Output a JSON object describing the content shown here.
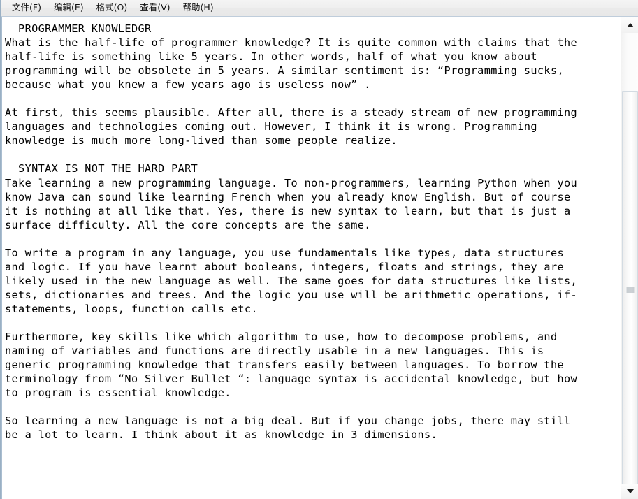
{
  "window": {
    "app_name": "notepad",
    "border_color": "#9ab0c4"
  },
  "menubar": {
    "items": [
      {
        "name": "file",
        "label": "文件(F)"
      },
      {
        "name": "edit",
        "label": "编辑(E)"
      },
      {
        "name": "format",
        "label": "格式(O)"
      },
      {
        "name": "view",
        "label": "查看(V)"
      },
      {
        "name": "help",
        "label": "帮助(H)"
      }
    ]
  },
  "editor": {
    "text": "  PROGRAMMER KNOWLEDGR\nWhat is the half-life of programmer knowledge? It is quite common with claims that the\nhalf-life is something like 5 years. In other words, half of what you know about\nprogramming will be obsolete in 5 years. A similar sentiment is: “Programming sucks,\nbecause what you knew a few years ago is useless now” .\n\nAt first, this seems plausible. After all, there is a steady stream of new programming\nlanguages and technologies coming out. However, I think it is wrong. Programming\nknowledge is much more long-lived than some people realize.\n\n  SYNTAX IS NOT THE HARD PART\nTake learning a new programming language. To non-programmers, learning Python when you\nknow Java can sound like learning French when you already know English. But of course\nit is nothing at all like that. Yes, there is new syntax to learn, but that is just a\nsurface difficulty. All the core concepts are the same.\n\nTo write a program in any language, you use fundamentals like types, data structures\nand logic. If you have learnt about booleans, integers, floats and strings, they are\nlikely used in the new language as well. The same goes for data structures like lists,\nsets, dictionaries and trees. And the logic you use will be arithmetic operations, if-\nstatements, loops, function calls etc.\n\nFurthermore, key skills like which algorithm to use, how to decompose problems, and\nnaming of variables and functions are directly usable in a new languages. This is\ngeneric programming knowledge that transfers easily between languages. To borrow the\nterminology from “No Silver Bullet “: language syntax is accidental knowledge, but how\nto program is essential knowledge.\n\nSo learning a new language is not a big deal. But if you change jobs, there may still\nbe a lot to learn. I think about it as knowledge in 3 dimensions.",
    "lines": [
      "  PROGRAMMER KNOWLEDGR",
      "What is the half-life of programmer knowledge? It is quite common with claims that the",
      "half-life is something like 5 years. In other words, half of what you know about",
      "programming will be obsolete in 5 years. A similar sentiment is: “Programming sucks,",
      "because what you knew a few years ago is useless now” .",
      "",
      "At first, this seems plausible. After all, there is a steady stream of new programming",
      "languages and technologies coming out. However, I think it is wrong. Programming",
      "knowledge is much more long-lived than some people realize.",
      "",
      "  SYNTAX IS NOT THE HARD PART",
      "Take learning a new programming language. To non-programmers, learning Python when you",
      "know Java can sound like learning French when you already know English. But of course",
      "it is nothing at all like that. Yes, there is new syntax to learn, but that is just a",
      "surface difficulty. All the core concepts are the same.",
      "",
      "To write a program in any language, you use fundamentals like types, data structures",
      "and logic. If you have learnt about booleans, integers, floats and strings, they are",
      "likely used in the new language as well. The same goes for data structures like lists,",
      "sets, dictionaries and trees. And the logic you use will be arithmetic operations, if-",
      "statements, loops, function calls etc.",
      "",
      "Furthermore, key skills like which algorithm to use, how to decompose problems, and",
      "naming of variables and functions are directly usable in a new languages. This is",
      "generic programming knowledge that transfers easily between languages. To borrow the",
      "terminology from “No Silver Bullet “: language syntax is accidental knowledge, but how",
      "to program is essential knowledge.",
      "",
      "So learning a new language is not a big deal. But if you change jobs, there may still",
      "be a lot to learn. I think about it as knowledge in 3 dimensions."
    ]
  },
  "scrollbar": {
    "orientation": "vertical",
    "up_arrow_icon": "triangle-up-icon",
    "down_arrow_icon": "triangle-down-icon",
    "thumb_grip_icon": "grip-lines-icon"
  }
}
